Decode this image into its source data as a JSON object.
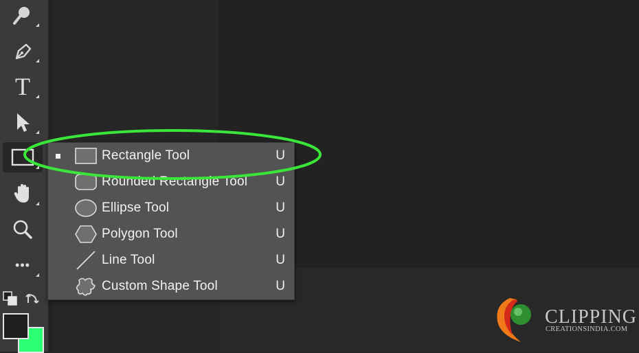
{
  "toolbar": {
    "tools": [
      {
        "icon": "magic-wand-icon"
      },
      {
        "icon": "pen-icon"
      },
      {
        "icon": "type-icon",
        "glyph": "T"
      },
      {
        "icon": "path-selection-icon"
      },
      {
        "icon": "rectangle-icon",
        "active": true
      },
      {
        "icon": "hand-icon"
      },
      {
        "icon": "zoom-icon"
      },
      {
        "icon": "more-icon",
        "glyph": "•••"
      }
    ],
    "foreground_color": "#1e1e1e",
    "background_color": "#2bff73"
  },
  "flyout": {
    "items": [
      {
        "label": "Rectangle Tool",
        "shortcut": "U",
        "icon": "rectangle-shape-icon",
        "selected": true
      },
      {
        "label": "Rounded Rectangle Tool",
        "shortcut": "U",
        "icon": "rounded-rectangle-shape-icon"
      },
      {
        "label": "Ellipse Tool",
        "shortcut": "U",
        "icon": "ellipse-shape-icon"
      },
      {
        "label": "Polygon Tool",
        "shortcut": "U",
        "icon": "polygon-shape-icon"
      },
      {
        "label": "Line Tool",
        "shortcut": "U",
        "icon": "line-shape-icon"
      },
      {
        "label": "Custom Shape Tool",
        "shortcut": "U",
        "icon": "custom-shape-icon"
      }
    ]
  },
  "highlight": {
    "color": "#39e639"
  },
  "logo": {
    "brand": "CLIPPING",
    "sub": "CREATIONSINDIA.COM"
  }
}
